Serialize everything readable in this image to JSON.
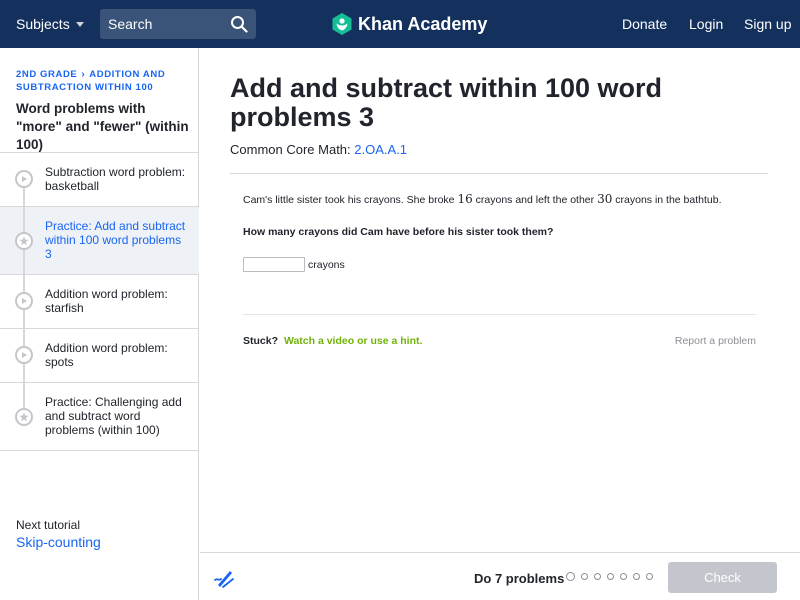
{
  "header": {
    "subjects_label": "Subjects",
    "search_placeholder": "Search",
    "logo_text": "Khan Academy",
    "donate": "Donate",
    "login": "Login",
    "signup": "Sign up",
    "bar_color": "#14315e"
  },
  "sidebar": {
    "breadcrumb": [
      "2nd grade",
      "Addition and subtraction within 100"
    ],
    "tutorial_title": "Word problems with \"more\" and \"fewer\" (within 100)",
    "items": [
      {
        "label": "Subtraction word problem: basketball",
        "icon": "play-icon",
        "active": false
      },
      {
        "label": "Practice: Add and subtract within 100 word problems 3",
        "icon": "star-icon",
        "active": true
      },
      {
        "label": "Addition word problem: starfish",
        "icon": "play-icon",
        "active": false
      },
      {
        "label": "Addition word problem: spots",
        "icon": "play-icon",
        "active": false
      },
      {
        "label": "Practice: Challenging add and subtract word problems (within 100)",
        "icon": "star-icon",
        "active": false
      }
    ],
    "next_label": "Next tutorial",
    "next_link": "Skip-counting"
  },
  "main": {
    "title": "Add and subtract within 100 word problems 3",
    "standard_prefix": "Common Core Math:",
    "standard_code": "2.OA.A.1",
    "question": {
      "part1": "Cam's little sister took his crayons. She broke",
      "num1": "16",
      "part2": "crayons and left the other",
      "num2": "30",
      "part3": "crayons in the bathtub."
    },
    "prompt": "How many crayons did Cam have before his sister took them?",
    "answer_value": "",
    "answer_unit": "crayons",
    "stuck_label": "Stuck?",
    "hint_link": "Watch a video or use a hint.",
    "report_link": "Report a problem"
  },
  "footer": {
    "progress_label": "Do 7 problems",
    "total_problems": 7,
    "completed": 0,
    "check_label": "Check"
  },
  "colors": {
    "link_blue": "#1865f2",
    "hint_green": "#71b307",
    "check_disabled": "#c3c7cd"
  }
}
